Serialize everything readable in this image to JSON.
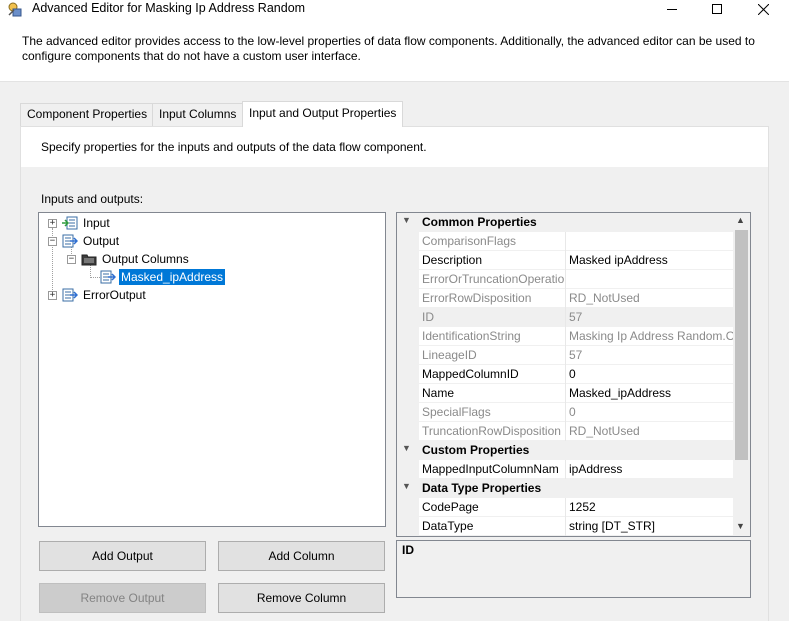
{
  "window": {
    "title": "Advanced Editor for Masking Ip Address Random",
    "icons": {
      "app": "ssis-component-icon",
      "minimize": "minimize-icon",
      "maximize": "maximize-icon",
      "close": "close-icon"
    }
  },
  "description": "The advanced editor provides access to the low-level properties of data flow components. Additionally, the advanced editor can be used to configure components that do not have a custom user interface.",
  "tabs": [
    {
      "label": "Component Properties",
      "active": false
    },
    {
      "label": "Input Columns",
      "active": false
    },
    {
      "label": "Input and Output Properties",
      "active": true
    }
  ],
  "panel": {
    "instruction": "Specify properties for the inputs and outputs of the data flow component.",
    "io_label": "Inputs and outputs:"
  },
  "tree": {
    "nodes": [
      {
        "label": "Input",
        "expander": "+",
        "icon": "input-icon"
      },
      {
        "label": "Output",
        "expander": "−",
        "icon": "output-icon"
      },
      {
        "label": "Output Columns",
        "expander": "−",
        "icon": "folder-icon"
      },
      {
        "label": "Masked_ipAddress",
        "expander": "",
        "icon": "column-icon",
        "selected": true
      },
      {
        "label": "ErrorOutput",
        "expander": "+",
        "icon": "output-icon"
      }
    ]
  },
  "properties": {
    "categories": [
      {
        "name": "Common Properties",
        "rows": [
          {
            "key": "ComparisonFlags",
            "value": "",
            "enabled": false
          },
          {
            "key": "Description",
            "value": "Masked ipAddress",
            "enabled": true
          },
          {
            "key": "ErrorOrTruncationOperatio",
            "value": "",
            "enabled": false
          },
          {
            "key": "ErrorRowDisposition",
            "value": "RD_NotUsed",
            "enabled": false
          },
          {
            "key": "ID",
            "value": "57",
            "enabled": false,
            "selected": true
          },
          {
            "key": "IdentificationString",
            "value": "Masking Ip Address Random.O",
            "enabled": false
          },
          {
            "key": "LineageID",
            "value": "57",
            "enabled": false
          },
          {
            "key": "MappedColumnID",
            "value": "0",
            "enabled": true
          },
          {
            "key": "Name",
            "value": "Masked_ipAddress",
            "enabled": true
          },
          {
            "key": "SpecialFlags",
            "value": "0",
            "enabled": false
          },
          {
            "key": "TruncationRowDisposition",
            "value": "RD_NotUsed",
            "enabled": false
          }
        ]
      },
      {
        "name": "Custom Properties",
        "rows": [
          {
            "key": "MappedInputColumnNam",
            "value": "ipAddress",
            "enabled": true
          }
        ]
      },
      {
        "name": "Data Type Properties",
        "rows": [
          {
            "key": "CodePage",
            "value": "1252",
            "enabled": true
          },
          {
            "key": "DataType",
            "value": "string [DT_STR]",
            "enabled": true
          }
        ]
      }
    ],
    "help_title": "ID"
  },
  "buttons": {
    "add_output": "Add Output",
    "add_column": "Add Column",
    "remove_output": "Remove Output",
    "remove_column": "Remove Column"
  }
}
